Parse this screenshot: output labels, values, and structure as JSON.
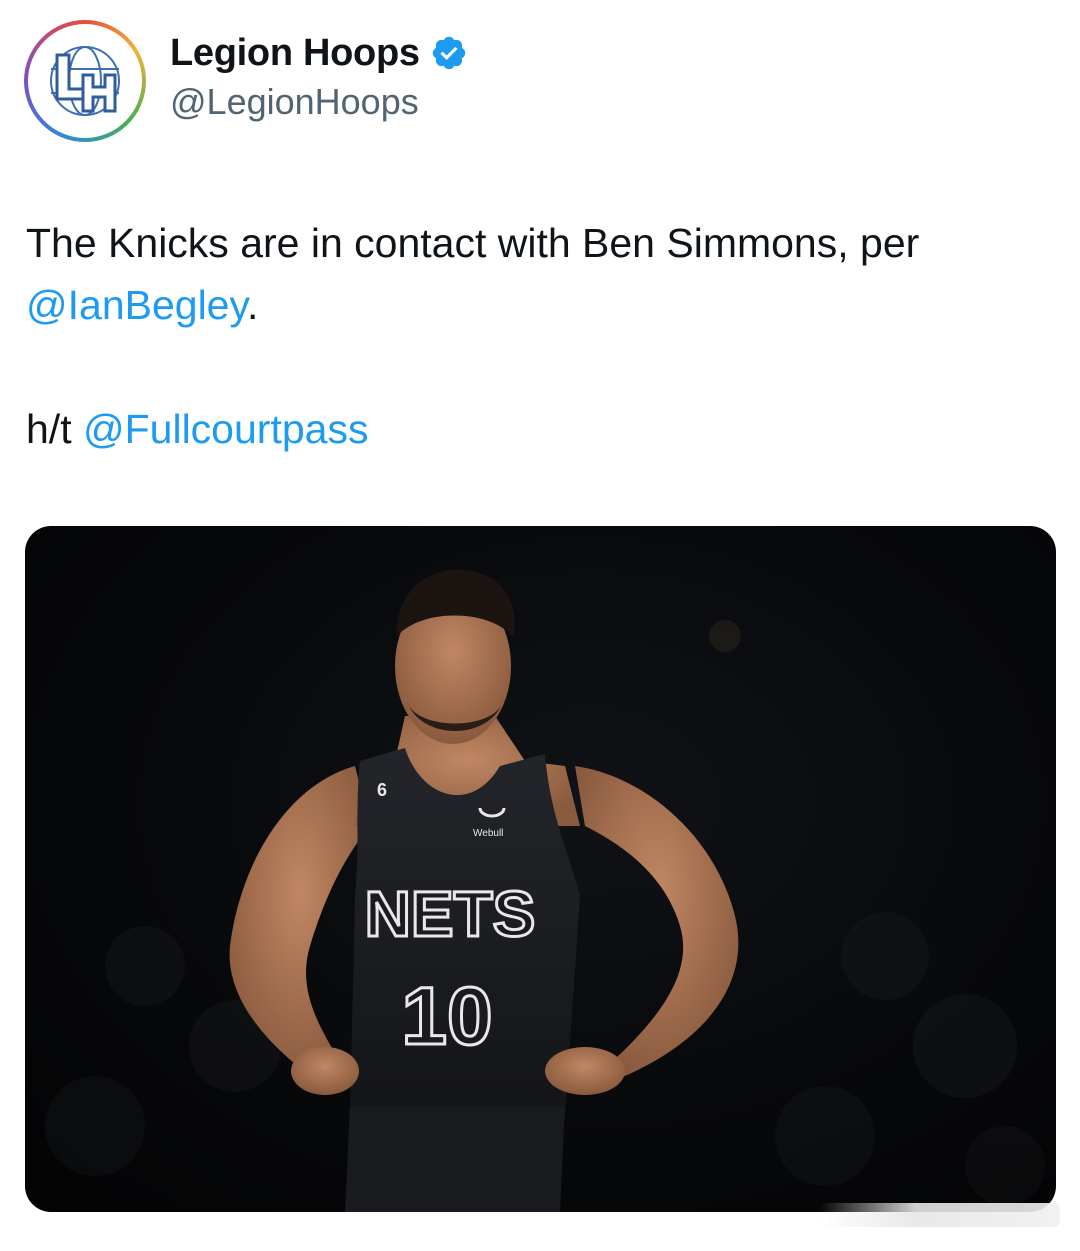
{
  "author": {
    "display_name": "Legion Hoops",
    "handle": "@LegionHoops",
    "verified": true,
    "avatar_icon": "legion-hoops-logo-icon",
    "verified_icon": "verified-badge-icon"
  },
  "tweet": {
    "line1_text": "The Knicks are in contact with Ben Simmons, per",
    "mention1": "@IanBegley",
    "mention1_suffix": ".",
    "ht_prefix": "h/t",
    "mention2": "@Fullcourtpass"
  },
  "media": {
    "jersey_team": "NETS",
    "jersey_number": "10",
    "jersey_small_number": "6",
    "jersey_sponsor": "Webull"
  },
  "colors": {
    "link": "#1d9bf0",
    "text": "#0f1419",
    "secondary_text": "#536471",
    "verified": "#1d9bf0"
  }
}
